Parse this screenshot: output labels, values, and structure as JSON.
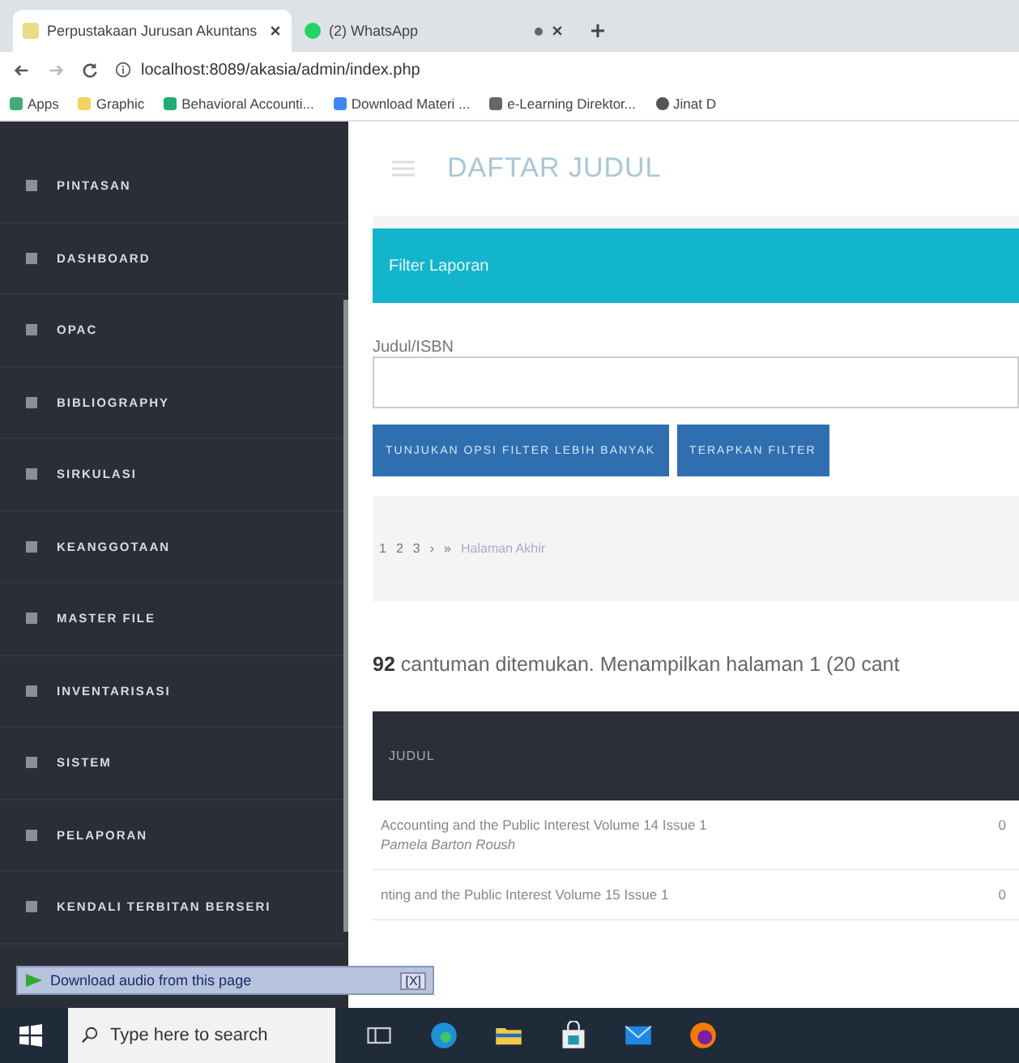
{
  "browser": {
    "tabs": [
      {
        "title": "Perpustakaan Jurusan Akuntans",
        "selected": true
      },
      {
        "title": "(2) WhatsApp",
        "selected": false
      }
    ],
    "address": "localhost:8089/akasia/admin/index.php",
    "bookmarks": [
      "Apps",
      "Graphic",
      "Behavioral Accounti...",
      "Download Materi ...",
      "e-Learning Direktor...",
      "Jinat D"
    ]
  },
  "sidebar": {
    "items": [
      "PINTASAN",
      "DASHBOARD",
      "OPAC",
      "BIBLIOGRAPHY",
      "SIRKULASI",
      "KEANGGOTAAN",
      "MASTER FILE",
      "INVENTARISASI",
      "SISTEM",
      "PELAPORAN",
      "KENDALI TERBITAN BERSERI"
    ]
  },
  "page": {
    "title": "DAFTAR JUDUL",
    "filter_title": "Filter Laporan",
    "field_label": "Judul/ISBN",
    "buttons": [
      "TUNJUKAN OPSI FILTER LEBIH BANYAK",
      "TERAPKAN FILTER"
    ],
    "pagination": [
      "1",
      "2",
      "3",
      "›",
      "»",
      "Halaman Akhir"
    ],
    "result": "**92** cantuman ditemukan. Menampilkan halaman 1 (20 cant"
  },
  "table": {
    "columns": [
      "JUDUL"
    ],
    "rows": [
      {
        "title": "Accounting and the Public Interest Volume 14 Issue 1",
        "author": "Pamela Barton Roush",
        "column_2": "0"
      },
      {
        "title": "nting and the Public Interest Volume 15 Issue 1",
        "column_2": "0"
      }
    ]
  },
  "download_bar": {
    "label": "Download audio from this page",
    "close": "[X]"
  },
  "taskbar": {
    "search": {
      "placeholder": "Type here to search"
    }
  }
}
